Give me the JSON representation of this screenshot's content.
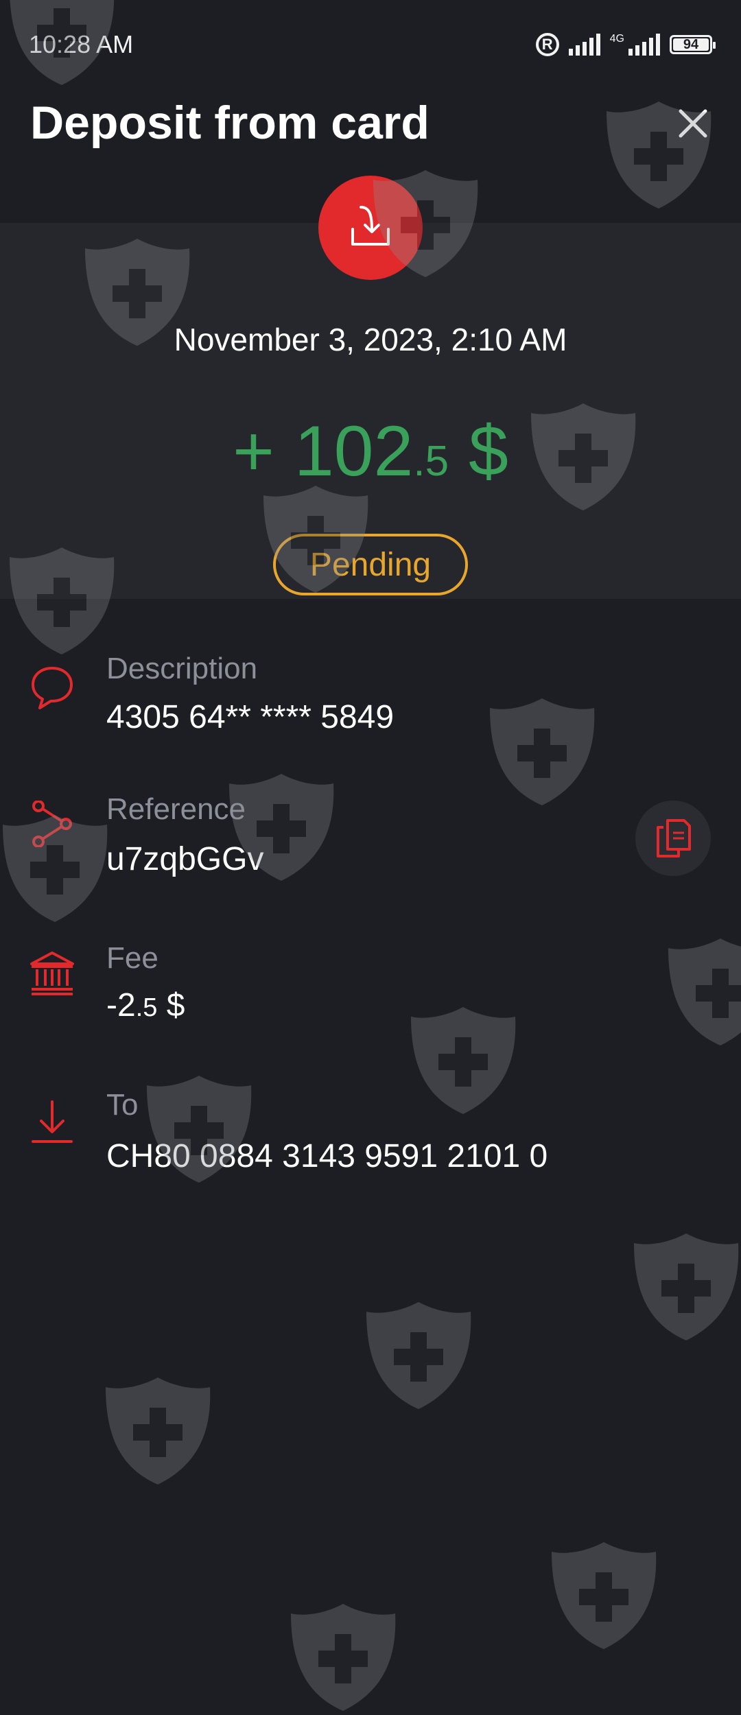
{
  "status_bar": {
    "time": "10:28 AM",
    "registered_mark": "R",
    "network_type": "4G",
    "battery_level": "94"
  },
  "header": {
    "title": "Deposit from card",
    "close_icon": "close-icon"
  },
  "transaction": {
    "icon": "download-tray-icon",
    "date": "November 3, 2023, 2:10 AM",
    "amount_sign": "+",
    "amount_integer": "102",
    "amount_decimals": ".5",
    "currency": "$",
    "status": "Pending"
  },
  "details": {
    "description": {
      "label": "Description",
      "value": "4305 64** **** 5849",
      "icon": "chat-bubble-icon"
    },
    "reference": {
      "label": "Reference",
      "value": "u7zqbGGv",
      "icon": "share-nodes-icon",
      "copy_icon": "copy-icon"
    },
    "fee": {
      "label": "Fee",
      "value_integer": "-2",
      "value_decimals": ".5",
      "currency": "$",
      "icon": "bank-icon"
    },
    "to": {
      "label": "To",
      "value": "CH80 0884 3143 9591 2101 0",
      "icon": "arrow-down-icon"
    }
  },
  "colors": {
    "background": "#1c1e24",
    "panel": "#25272d",
    "accent_red": "#e22a2c",
    "amount_green": "#3aa15a",
    "pending_orange": "#e8a72c",
    "label_gray": "#8d9099"
  }
}
